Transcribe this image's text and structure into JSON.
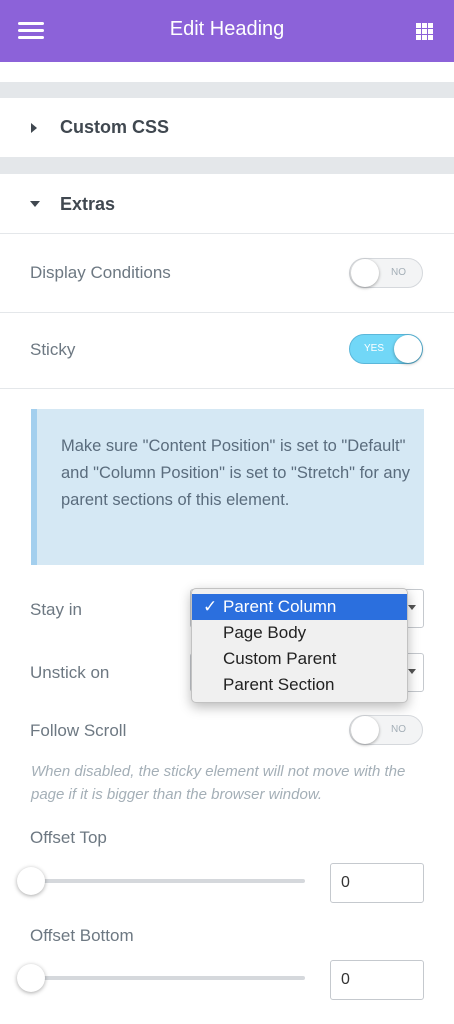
{
  "header": {
    "title": "Edit Heading",
    "menu_icon": "hamburger-icon",
    "apps_icon": "grid-icon",
    "accent": "#8c62d9"
  },
  "sections": {
    "custom_css": {
      "label": "Custom CSS",
      "expanded": false
    },
    "extras": {
      "label": "Extras",
      "expanded": true
    }
  },
  "controls": {
    "display_conditions": {
      "label": "Display Conditions",
      "toggle_text": "NO",
      "on": false
    },
    "sticky": {
      "label": "Sticky",
      "toggle_text": "YES",
      "on": true
    },
    "notice": "Make sure \"Content Position\" is set to \"Default\" and \"Column Position\" is set to \"Stretch\" for any parent sections of this element.",
    "stay_in": {
      "label": "Stay in",
      "value": "Parent Column"
    },
    "unstick_on": {
      "label": "Unstick on"
    },
    "dropdown": {
      "options": [
        "Parent Column",
        "Page Body",
        "Custom Parent",
        "Parent Section"
      ],
      "selected": "Parent Column",
      "check_mark": "✓"
    },
    "follow_scroll": {
      "label": "Follow Scroll",
      "toggle_text": "NO",
      "on": false,
      "hint": "When disabled, the sticky element will not move with the page if it is bigger than the browser window."
    },
    "offset_top": {
      "label": "Offset Top",
      "value": "0"
    },
    "offset_bottom": {
      "label": "Offset Bottom",
      "value": "0"
    }
  }
}
